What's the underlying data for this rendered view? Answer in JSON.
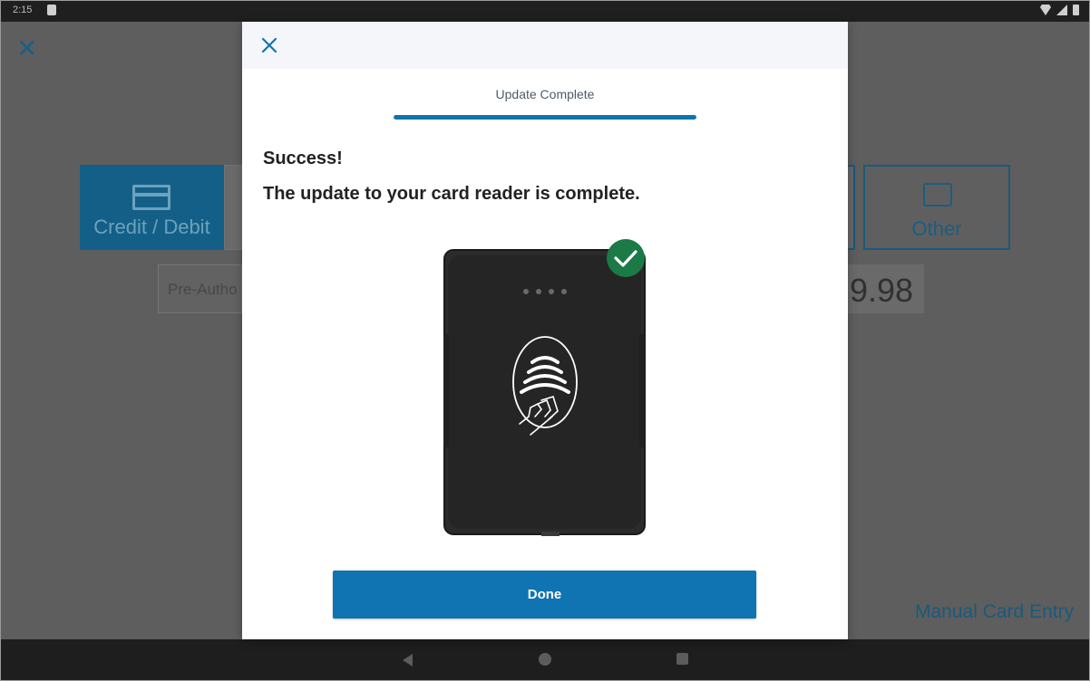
{
  "status_bar": {
    "time": "2:15"
  },
  "background": {
    "tiles": {
      "credit_debit": "Credit / Debit",
      "other": "Other"
    },
    "pre_auth": "Pre-Autho",
    "amount_partial": "9.98",
    "manual_card_entry": "Manual Card Entry"
  },
  "modal": {
    "step_title": "Update Complete",
    "progress": 1.0,
    "heading": "Success!",
    "message": "The update to your card reader is complete.",
    "done_label": "Done",
    "icons": {
      "close": "close-icon",
      "check": "check-circle-icon",
      "contactless": "contactless-tap-icon"
    },
    "colors": {
      "accent": "#0f74b1",
      "success": "#1b7a46",
      "device": "#2b2b2b"
    }
  }
}
